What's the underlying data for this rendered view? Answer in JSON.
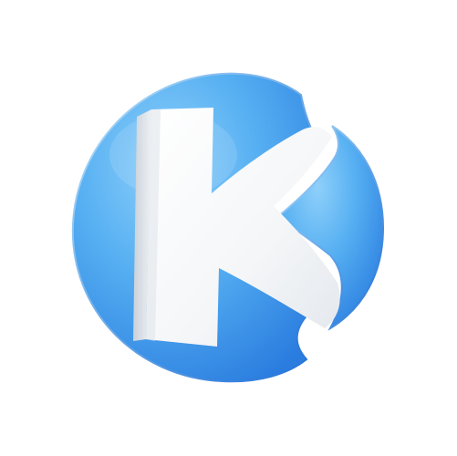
{
  "logo": {
    "icon": "k-logo-icon",
    "colors": {
      "background": "#ffffff",
      "disc_light": "#7cc6f6",
      "disc_mid": "#49a6ef",
      "disc_dark": "#2b7fe0",
      "letter": "#f6f7f8",
      "letter_shadow": "#d5d9df"
    }
  }
}
